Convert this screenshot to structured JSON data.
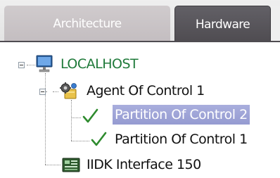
{
  "tabs": [
    {
      "label": "Architecture",
      "active": false
    },
    {
      "label": "Hardware",
      "active": true
    }
  ],
  "tree": {
    "root": {
      "label": "LOCALHOST",
      "icon": "computer-icon",
      "expanded": true
    },
    "agent": {
      "label": "Agent Of Control 1",
      "icon": "agent-icon",
      "expanded": true
    },
    "partitions": [
      {
        "label": "Partition Of Control 2",
        "icon": "checkmark-icon",
        "selected": true
      },
      {
        "label": "Partition Of Control 1",
        "icon": "checkmark-icon",
        "selected": false
      }
    ],
    "interface": {
      "label": "IIDK Interface 150",
      "icon": "interface-board-icon"
    }
  },
  "colors": {
    "localhost_text": "#1f7a3a",
    "selection": "#a2a7d8",
    "active_tab": "#57545a",
    "inactive_tab": "#c8c2c5",
    "checkmark": "#2e8b2e"
  }
}
